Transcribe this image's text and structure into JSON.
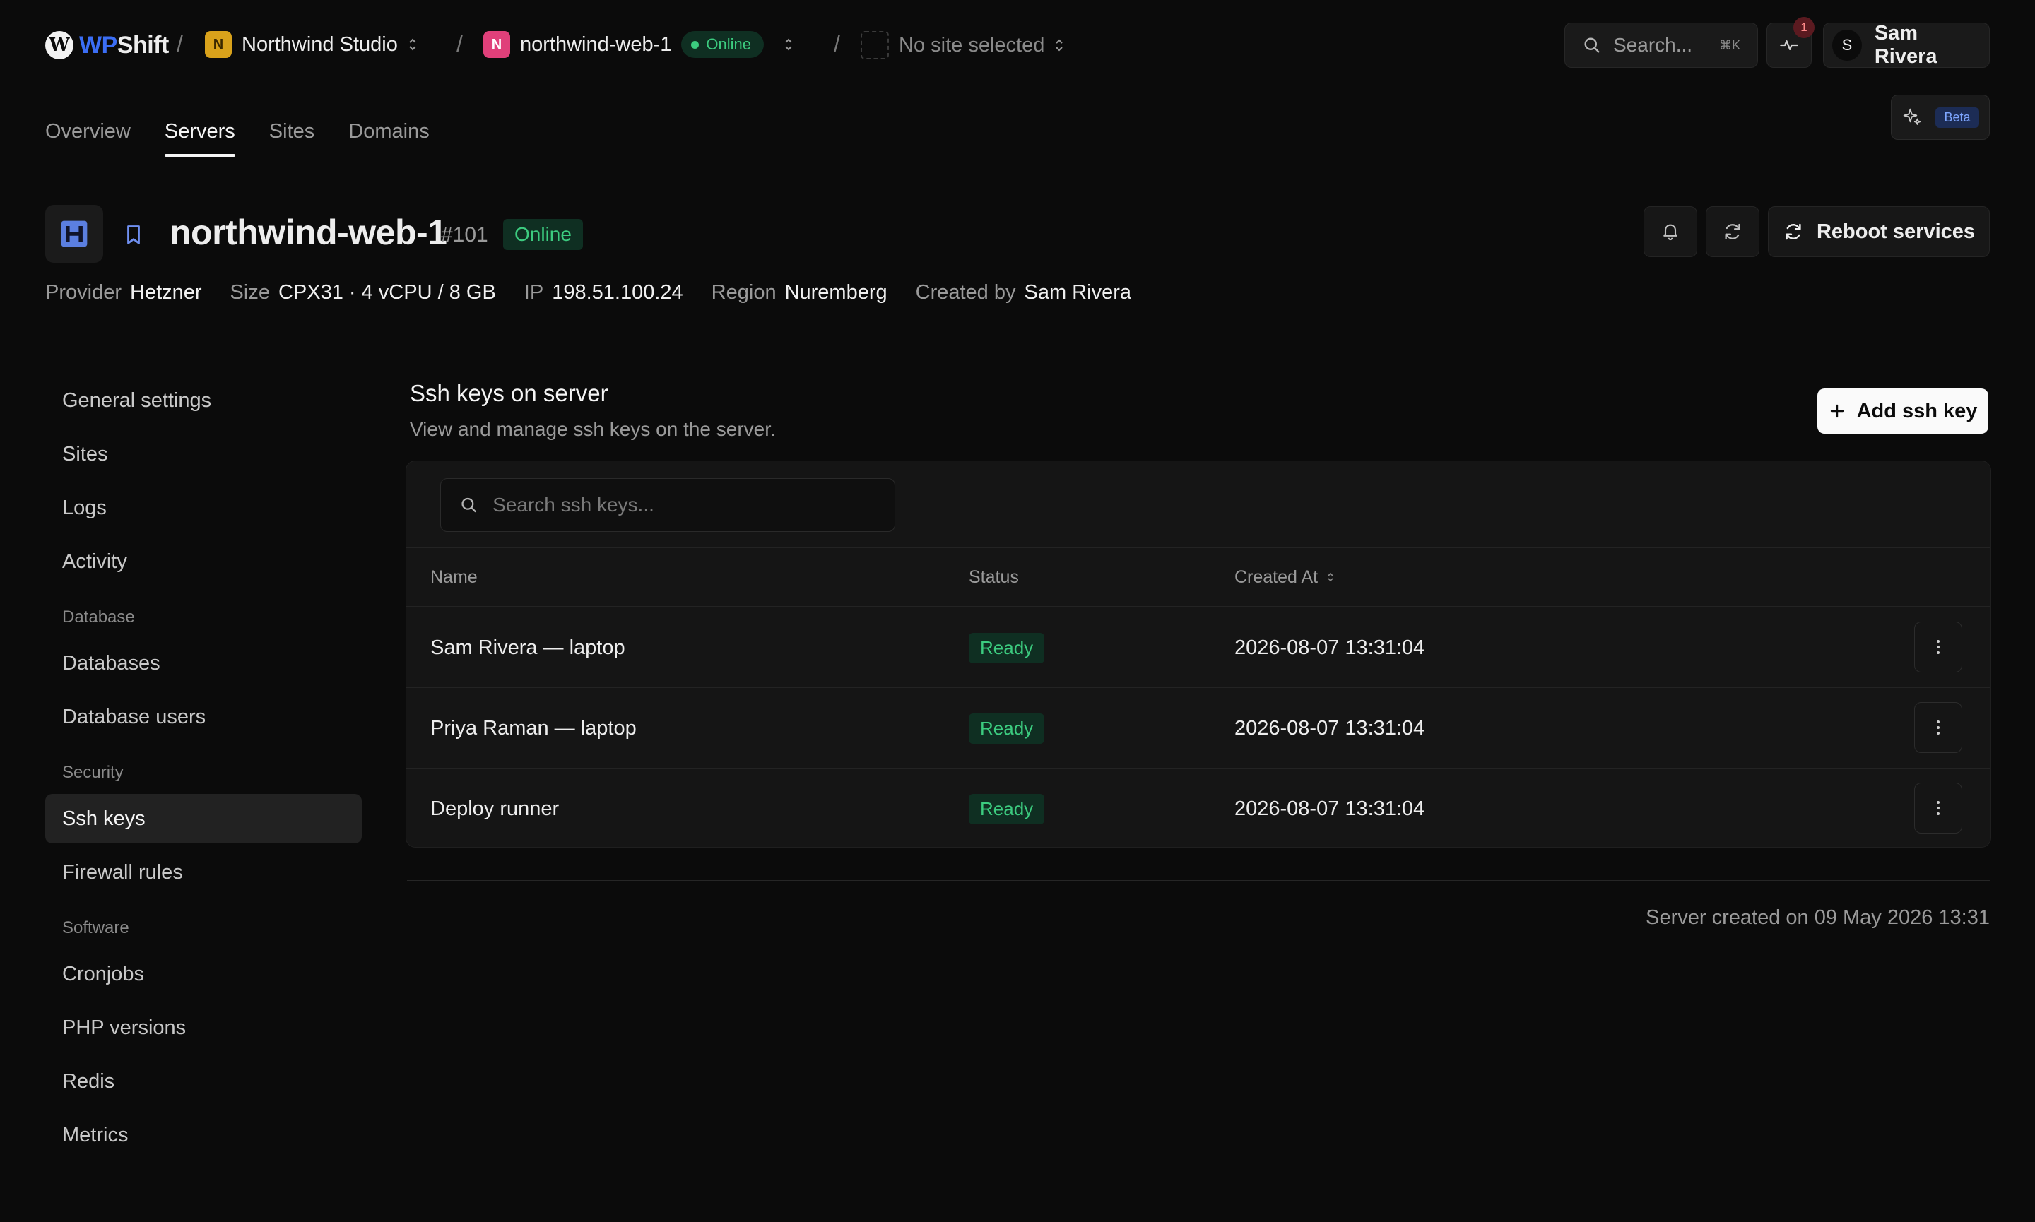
{
  "brand": {
    "mark": "W",
    "name_prefix": "WP",
    "name_suffix": "Shift"
  },
  "breadcrumb": {
    "separator": "/",
    "team": {
      "initial": "N",
      "name": "Northwind Studio",
      "color": "#d9a21b"
    },
    "server": {
      "initial": "N",
      "name": "northwind-web-1",
      "color": "#e0407a",
      "status": "Online"
    },
    "site": {
      "placeholder": "No site selected"
    }
  },
  "search": {
    "placeholder": "Search...",
    "shortcut": "⌘K"
  },
  "activity": {
    "count": "1"
  },
  "user": {
    "initial": "S",
    "name": "Sam Rivera"
  },
  "nav": {
    "tabs": [
      {
        "label": "Overview",
        "active": false
      },
      {
        "label": "Servers",
        "active": true
      },
      {
        "label": "Sites",
        "active": false
      },
      {
        "label": "Domains",
        "active": false
      }
    ],
    "ai_badge": "Beta"
  },
  "server": {
    "name": "northwind-web-1",
    "number": "#101",
    "status": "Online",
    "reboot_label": "Reboot services",
    "meta": [
      {
        "key": "Provider",
        "value": "Hetzner"
      },
      {
        "key": "Size",
        "value": "CPX31 · 4 vCPU / 8 GB"
      },
      {
        "key": "IP",
        "value": "198.51.100.24"
      },
      {
        "key": "Region",
        "value": "Nuremberg"
      },
      {
        "key": "Created by",
        "value": "Sam Rivera"
      }
    ]
  },
  "sidebar": {
    "general": [
      "General settings",
      "Sites",
      "Logs",
      "Activity"
    ],
    "database_label": "Database",
    "database": [
      "Databases",
      "Database users"
    ],
    "security_label": "Security",
    "security": [
      "Ssh keys",
      "Firewall rules"
    ],
    "software_label": "Software",
    "software": [
      "Cronjobs",
      "PHP versions",
      "Redis",
      "Metrics"
    ],
    "active": "Ssh keys"
  },
  "main": {
    "title": "Ssh keys on server",
    "subtitle": "View and manage ssh keys on the server.",
    "add_label": "Add ssh key",
    "search_placeholder": "Search ssh keys...",
    "columns": {
      "name": "Name",
      "status": "Status",
      "created": "Created At"
    },
    "rows": [
      {
        "name": "Sam Rivera — laptop",
        "status": "Ready",
        "created": "2026-08-07 13:31:04"
      },
      {
        "name": "Priya Raman — laptop",
        "status": "Ready",
        "created": "2026-08-07 13:31:04"
      },
      {
        "name": "Deploy runner",
        "status": "Ready",
        "created": "2026-08-07 13:31:04"
      }
    ],
    "footer": "Server created on 09 May 2026 13:31"
  }
}
